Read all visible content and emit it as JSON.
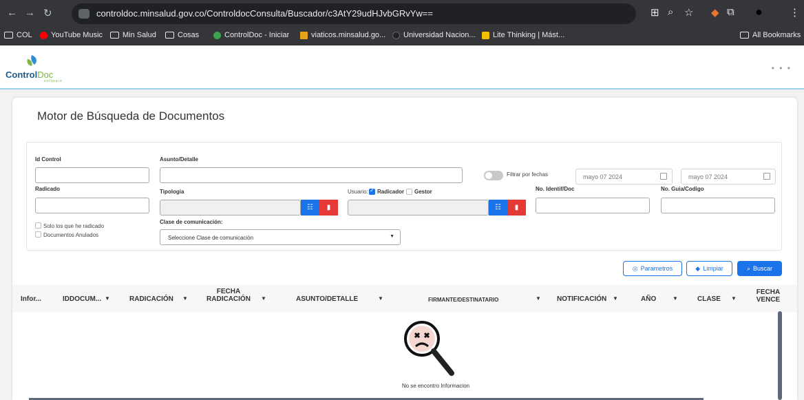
{
  "browser": {
    "url": "controldoc.minsalud.gov.co/ControldocConsulta/Buscador/c3AtY29udHJvbGRvYw==",
    "bookmarks": [
      "COL",
      "YouTube Music",
      "Min Salud",
      "Cosas",
      "ControlDoc - Iniciar",
      "viaticos.minsalud.go...",
      "Universidad Nacion...",
      "Lite Thinking | Mást..."
    ],
    "all_bookmarks": "All Bookmarks"
  },
  "app": {
    "logo_main": "Control",
    "logo_accent": "Doc",
    "logo_sub": "software",
    "menu_icon": "more-horizontal-icon"
  },
  "page": {
    "title": "Motor de Búsqueda de Documentos"
  },
  "filters": {
    "id_control": "Id Control",
    "asunto": "Asunto/Detalle",
    "filtrar_fechas": "Filtrar por fechas",
    "fecha_desde": "mayo 07 2024",
    "fecha_hasta": "mayo 07 2024",
    "radicado": "Radicado",
    "tipologia": "Tipologia",
    "usuario": "Usuario:",
    "radicador": "Radicador",
    "gestor": "Gestor",
    "no_identif": "No. Identif/Doc",
    "no_guia": "No. Guia/Codigo",
    "solo_radicado": "Solo los que he radicado",
    "anulados": "Documentos Anulados",
    "clase_label": "Clase de comunicación:",
    "clase_value": "Seleccione Clase de comunicación",
    "radicador_checked": true
  },
  "actions": {
    "parametros": "Parametros",
    "limpiar": "Limpiar",
    "buscar": "Buscar"
  },
  "table": {
    "columns": [
      "Infor...",
      "IDDOCUM...",
      "RADICACIÓN",
      "FECHA RADICACIÓN",
      "ASUNTO/DETALLE",
      "FIRMANTE/DESTINATARIO",
      "NOTIFICACIÓN",
      "AÑO",
      "CLASE",
      "FECHA VENCE"
    ],
    "empty_message": "No se encontro Informacion"
  },
  "colors": {
    "accent": "#1a73e8",
    "danger": "#e53935",
    "chrome": "#35363a"
  }
}
